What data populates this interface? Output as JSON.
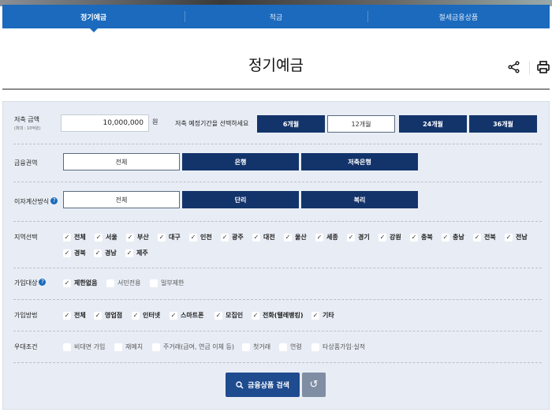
{
  "tabs": [
    {
      "label": "정기예금",
      "active": true
    },
    {
      "label": "적금",
      "active": false
    },
    {
      "label": "절세금융상품",
      "active": false
    }
  ],
  "page_title": "정기예금",
  "icons": {
    "share": "share-icon",
    "print": "print-icon",
    "help": "question-icon",
    "search": "search-icon",
    "reset": "refresh-icon"
  },
  "colors": {
    "tab_bar": "#1b6abd",
    "navy": "#13346b",
    "panel_bg": "#e8edf5",
    "search_button": "#1f4b8f",
    "reset_button": "#7f8ea3"
  },
  "amount": {
    "label": "저축 금액",
    "sublabel": "(최대 : 10억원)",
    "value": "10,000,000",
    "unit": "원"
  },
  "period": {
    "label": "저축 예정기간을 선택하세요",
    "options": [
      {
        "label": "6개월",
        "selected": false
      },
      {
        "label": "12개월",
        "selected": true
      },
      {
        "label": "24개월",
        "selected": false
      },
      {
        "label": "36개월",
        "selected": false
      }
    ]
  },
  "sector": {
    "label": "금융권역",
    "options": [
      {
        "label": "전체",
        "selected": true
      },
      {
        "label": "은행",
        "selected": false
      },
      {
        "label": "저축은행",
        "selected": false
      }
    ]
  },
  "interest": {
    "label": "이자계산방식",
    "options": [
      {
        "label": "전체",
        "selected": true
      },
      {
        "label": "단리",
        "selected": false
      },
      {
        "label": "복리",
        "selected": false
      }
    ]
  },
  "region": {
    "label": "지역선택",
    "items": [
      {
        "label": "전체",
        "checked": true
      },
      {
        "label": "서울",
        "checked": true
      },
      {
        "label": "부산",
        "checked": true
      },
      {
        "label": "대구",
        "checked": true
      },
      {
        "label": "인천",
        "checked": true
      },
      {
        "label": "광주",
        "checked": true
      },
      {
        "label": "대전",
        "checked": true
      },
      {
        "label": "울산",
        "checked": true
      },
      {
        "label": "세종",
        "checked": true
      },
      {
        "label": "경기",
        "checked": true
      },
      {
        "label": "강원",
        "checked": true
      },
      {
        "label": "충북",
        "checked": true
      },
      {
        "label": "충남",
        "checked": true
      },
      {
        "label": "전북",
        "checked": true
      },
      {
        "label": "전남",
        "checked": true
      },
      {
        "label": "경북",
        "checked": true
      },
      {
        "label": "경남",
        "checked": true
      },
      {
        "label": "제주",
        "checked": true
      }
    ]
  },
  "target": {
    "label": "가입대상",
    "items": [
      {
        "label": "제한없음",
        "checked": true
      },
      {
        "label": "서민전용",
        "checked": false
      },
      {
        "label": "일부제한",
        "checked": false
      }
    ]
  },
  "method": {
    "label": "가입방법",
    "items": [
      {
        "label": "전체",
        "checked": true
      },
      {
        "label": "영업점",
        "checked": true
      },
      {
        "label": "인터넷",
        "checked": true
      },
      {
        "label": "스마트폰",
        "checked": true
      },
      {
        "label": "모집인",
        "checked": true
      },
      {
        "label": "전화(텔레뱅킹)",
        "checked": true
      },
      {
        "label": "기타",
        "checked": true
      }
    ]
  },
  "benefit": {
    "label": "우대조건",
    "items": [
      {
        "label": "비대면 가입",
        "checked": false
      },
      {
        "label": "재예치",
        "checked": false
      },
      {
        "label": "주거래(급여, 연금 이체 등)",
        "checked": false
      },
      {
        "label": "첫거래",
        "checked": false
      },
      {
        "label": "연령",
        "checked": false
      },
      {
        "label": "타상품가입·실적",
        "checked": false
      }
    ]
  },
  "search_button": "금융상품 검색"
}
